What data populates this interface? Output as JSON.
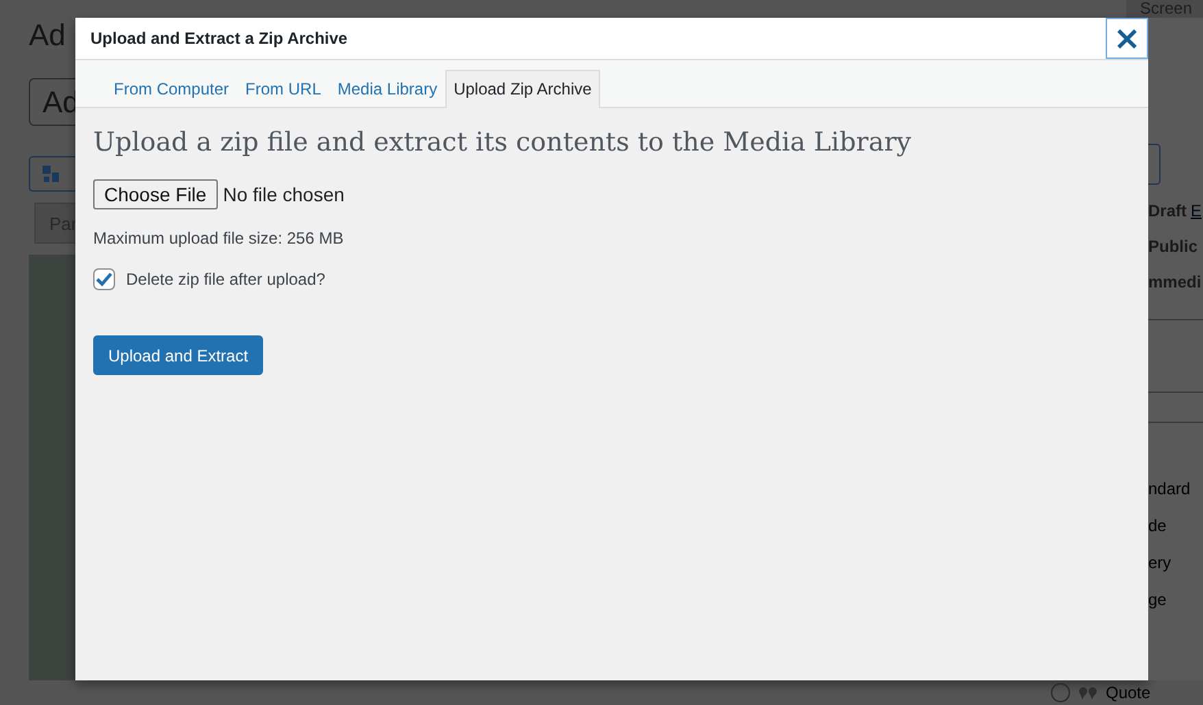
{
  "background": {
    "heading": "Ad",
    "title_field": "Ad",
    "block_field": "Par",
    "screen_options": "Screen",
    "status": "Draft",
    "edit_link": "E",
    "visibility": "Public",
    "publish": "mmedi",
    "formats": [
      {
        "label": "ndard"
      },
      {
        "label": "de"
      },
      {
        "label": "ery"
      },
      {
        "label": "ge"
      }
    ],
    "quote_format": {
      "label": "Quote",
      "selected": false
    }
  },
  "modal": {
    "title": "Upload and Extract a Zip Archive",
    "close": "×",
    "tabs": [
      {
        "label": "From Computer",
        "selected": false
      },
      {
        "label": "From URL",
        "selected": false
      },
      {
        "label": "Media Library",
        "selected": false
      },
      {
        "label": "Upload Zip Archive",
        "selected": true
      }
    ],
    "heading": "Upload a zip file and extract its contents to the Media Library",
    "file_button": "Choose File",
    "file_status": "No file chosen",
    "max_size": "Maximum upload file size: 256 MB",
    "delete_option": {
      "label": "Delete zip file after upload?",
      "checked": true
    },
    "submit": "Upload and Extract"
  }
}
